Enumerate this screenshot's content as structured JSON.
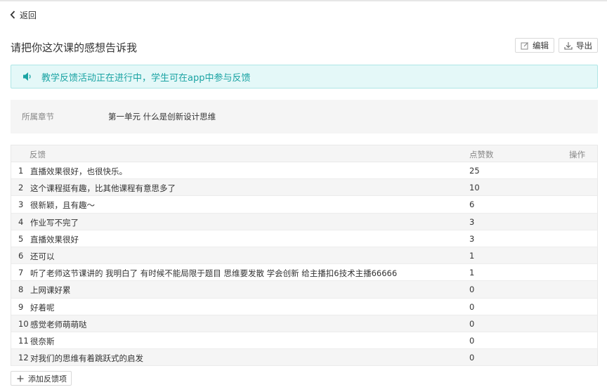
{
  "nav": {
    "back_label": "返回"
  },
  "page": {
    "title": "请把你这次课的感想告诉我"
  },
  "toolbar": {
    "edit_label": "编辑",
    "export_label": "导出"
  },
  "notice": {
    "text": "教学反馈活动正在进行中，学生可在app中参与反馈",
    "icon": "speaker-icon",
    "color": "#1aa3a3"
  },
  "chapter": {
    "label": "所属章节",
    "value": "第一单元 什么是创新设计思维"
  },
  "table": {
    "headers": {
      "feedback": "反馈",
      "likes": "点赞数",
      "actions": "操作"
    },
    "rows": [
      {
        "index": "1",
        "text": "直播效果很好，也很快乐。",
        "likes": "25"
      },
      {
        "index": "2",
        "text": "这个课程挺有趣，比其他课程有意思多了",
        "likes": "10"
      },
      {
        "index": "3",
        "text": "很新颖，且有趣～",
        "likes": "6"
      },
      {
        "index": "4",
        "text": "作业写不完了",
        "likes": "3"
      },
      {
        "index": "5",
        "text": "直播效果很好",
        "likes": "3"
      },
      {
        "index": "6",
        "text": "还可以",
        "likes": "1"
      },
      {
        "index": "7",
        "text": "听了老师这节课讲的 我明白了 有时候不能局限于题目 思维要发散 学会创新 给主播扣6技术主播66666",
        "likes": "1"
      },
      {
        "index": "8",
        "text": "上网课好累",
        "likes": "0"
      },
      {
        "index": "9",
        "text": "好着呢",
        "likes": "0"
      },
      {
        "index": "10",
        "text": "感觉老师萌萌哒",
        "likes": "0"
      },
      {
        "index": "11",
        "text": "很奈斯",
        "likes": "0"
      },
      {
        "index": "12",
        "text": "对我们的思维有着跳跃式的启发",
        "likes": "0"
      }
    ]
  },
  "footer": {
    "add_label": "添加反馈项"
  }
}
